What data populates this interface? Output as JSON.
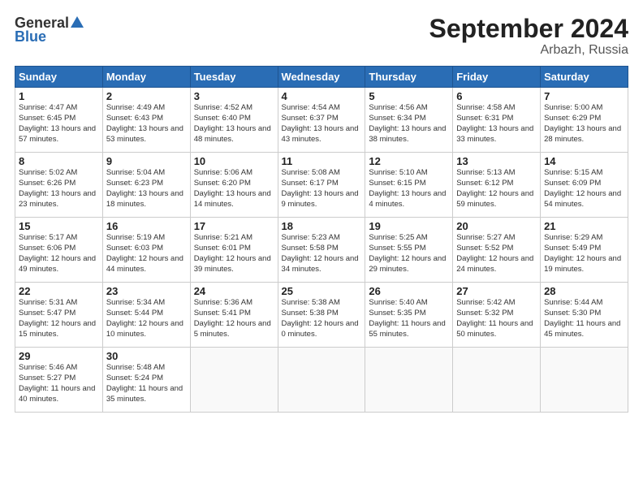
{
  "header": {
    "logo_general": "General",
    "logo_blue": "Blue",
    "title": "September 2024",
    "subtitle": "Arbazh, Russia"
  },
  "weekdays": [
    "Sunday",
    "Monday",
    "Tuesday",
    "Wednesday",
    "Thursday",
    "Friday",
    "Saturday"
  ],
  "weeks": [
    [
      {
        "day": "1",
        "sunrise": "Sunrise: 4:47 AM",
        "sunset": "Sunset: 6:45 PM",
        "daylight": "Daylight: 13 hours and 57 minutes."
      },
      {
        "day": "2",
        "sunrise": "Sunrise: 4:49 AM",
        "sunset": "Sunset: 6:43 PM",
        "daylight": "Daylight: 13 hours and 53 minutes."
      },
      {
        "day": "3",
        "sunrise": "Sunrise: 4:52 AM",
        "sunset": "Sunset: 6:40 PM",
        "daylight": "Daylight: 13 hours and 48 minutes."
      },
      {
        "day": "4",
        "sunrise": "Sunrise: 4:54 AM",
        "sunset": "Sunset: 6:37 PM",
        "daylight": "Daylight: 13 hours and 43 minutes."
      },
      {
        "day": "5",
        "sunrise": "Sunrise: 4:56 AM",
        "sunset": "Sunset: 6:34 PM",
        "daylight": "Daylight: 13 hours and 38 minutes."
      },
      {
        "day": "6",
        "sunrise": "Sunrise: 4:58 AM",
        "sunset": "Sunset: 6:31 PM",
        "daylight": "Daylight: 13 hours and 33 minutes."
      },
      {
        "day": "7",
        "sunrise": "Sunrise: 5:00 AM",
        "sunset": "Sunset: 6:29 PM",
        "daylight": "Daylight: 13 hours and 28 minutes."
      }
    ],
    [
      {
        "day": "8",
        "sunrise": "Sunrise: 5:02 AM",
        "sunset": "Sunset: 6:26 PM",
        "daylight": "Daylight: 13 hours and 23 minutes."
      },
      {
        "day": "9",
        "sunrise": "Sunrise: 5:04 AM",
        "sunset": "Sunset: 6:23 PM",
        "daylight": "Daylight: 13 hours and 18 minutes."
      },
      {
        "day": "10",
        "sunrise": "Sunrise: 5:06 AM",
        "sunset": "Sunset: 6:20 PM",
        "daylight": "Daylight: 13 hours and 14 minutes."
      },
      {
        "day": "11",
        "sunrise": "Sunrise: 5:08 AM",
        "sunset": "Sunset: 6:17 PM",
        "daylight": "Daylight: 13 hours and 9 minutes."
      },
      {
        "day": "12",
        "sunrise": "Sunrise: 5:10 AM",
        "sunset": "Sunset: 6:15 PM",
        "daylight": "Daylight: 13 hours and 4 minutes."
      },
      {
        "day": "13",
        "sunrise": "Sunrise: 5:13 AM",
        "sunset": "Sunset: 6:12 PM",
        "daylight": "Daylight: 12 hours and 59 minutes."
      },
      {
        "day": "14",
        "sunrise": "Sunrise: 5:15 AM",
        "sunset": "Sunset: 6:09 PM",
        "daylight": "Daylight: 12 hours and 54 minutes."
      }
    ],
    [
      {
        "day": "15",
        "sunrise": "Sunrise: 5:17 AM",
        "sunset": "Sunset: 6:06 PM",
        "daylight": "Daylight: 12 hours and 49 minutes."
      },
      {
        "day": "16",
        "sunrise": "Sunrise: 5:19 AM",
        "sunset": "Sunset: 6:03 PM",
        "daylight": "Daylight: 12 hours and 44 minutes."
      },
      {
        "day": "17",
        "sunrise": "Sunrise: 5:21 AM",
        "sunset": "Sunset: 6:01 PM",
        "daylight": "Daylight: 12 hours and 39 minutes."
      },
      {
        "day": "18",
        "sunrise": "Sunrise: 5:23 AM",
        "sunset": "Sunset: 5:58 PM",
        "daylight": "Daylight: 12 hours and 34 minutes."
      },
      {
        "day": "19",
        "sunrise": "Sunrise: 5:25 AM",
        "sunset": "Sunset: 5:55 PM",
        "daylight": "Daylight: 12 hours and 29 minutes."
      },
      {
        "day": "20",
        "sunrise": "Sunrise: 5:27 AM",
        "sunset": "Sunset: 5:52 PM",
        "daylight": "Daylight: 12 hours and 24 minutes."
      },
      {
        "day": "21",
        "sunrise": "Sunrise: 5:29 AM",
        "sunset": "Sunset: 5:49 PM",
        "daylight": "Daylight: 12 hours and 19 minutes."
      }
    ],
    [
      {
        "day": "22",
        "sunrise": "Sunrise: 5:31 AM",
        "sunset": "Sunset: 5:47 PM",
        "daylight": "Daylight: 12 hours and 15 minutes."
      },
      {
        "day": "23",
        "sunrise": "Sunrise: 5:34 AM",
        "sunset": "Sunset: 5:44 PM",
        "daylight": "Daylight: 12 hours and 10 minutes."
      },
      {
        "day": "24",
        "sunrise": "Sunrise: 5:36 AM",
        "sunset": "Sunset: 5:41 PM",
        "daylight": "Daylight: 12 hours and 5 minutes."
      },
      {
        "day": "25",
        "sunrise": "Sunrise: 5:38 AM",
        "sunset": "Sunset: 5:38 PM",
        "daylight": "Daylight: 12 hours and 0 minutes."
      },
      {
        "day": "26",
        "sunrise": "Sunrise: 5:40 AM",
        "sunset": "Sunset: 5:35 PM",
        "daylight": "Daylight: 11 hours and 55 minutes."
      },
      {
        "day": "27",
        "sunrise": "Sunrise: 5:42 AM",
        "sunset": "Sunset: 5:32 PM",
        "daylight": "Daylight: 11 hours and 50 minutes."
      },
      {
        "day": "28",
        "sunrise": "Sunrise: 5:44 AM",
        "sunset": "Sunset: 5:30 PM",
        "daylight": "Daylight: 11 hours and 45 minutes."
      }
    ],
    [
      {
        "day": "29",
        "sunrise": "Sunrise: 5:46 AM",
        "sunset": "Sunset: 5:27 PM",
        "daylight": "Daylight: 11 hours and 40 minutes."
      },
      {
        "day": "30",
        "sunrise": "Sunrise: 5:48 AM",
        "sunset": "Sunset: 5:24 PM",
        "daylight": "Daylight: 11 hours and 35 minutes."
      },
      null,
      null,
      null,
      null,
      null
    ]
  ]
}
